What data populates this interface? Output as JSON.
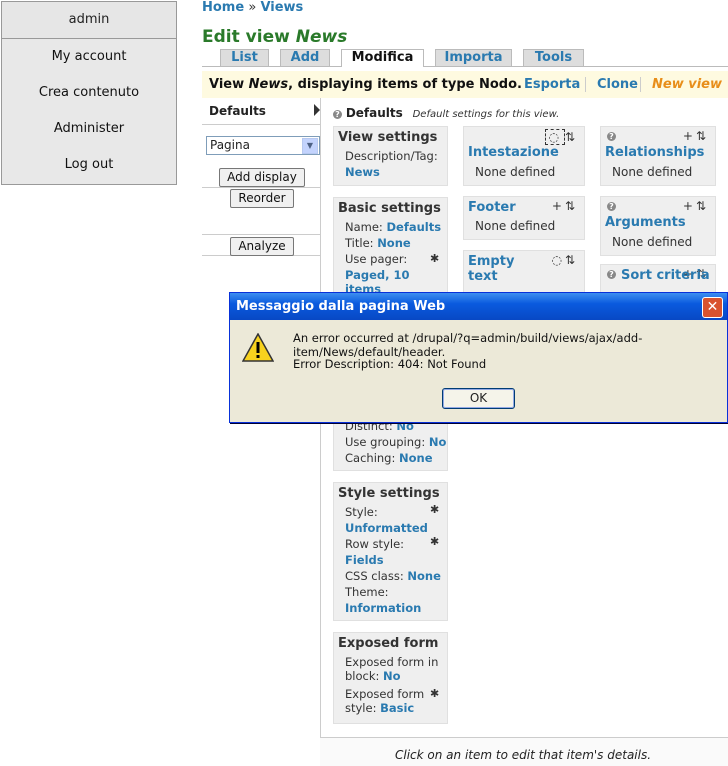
{
  "user_menu": {
    "username": "admin",
    "items": [
      "My account",
      "Crea contenuto",
      "Administer",
      "Log out"
    ]
  },
  "breadcrumb": {
    "home": "Home",
    "sep": "»",
    "views": "Views"
  },
  "title": {
    "prefix": "Edit view",
    "name": "News"
  },
  "tabs": [
    "List",
    "Add",
    "Modifica",
    "Importa",
    "Tools"
  ],
  "active_tab": "Modifica",
  "infobar": {
    "text_prefix": "View",
    "view_name": "News",
    "text_suffix": ", displaying items of type Nodo.",
    "export": "Esporta",
    "clone": "Clone",
    "new_view": "New view"
  },
  "displays": {
    "defaults": "Defaults",
    "select_value": "Pagina",
    "add_display": "Add display",
    "reorder": "Reorder",
    "analyze": "Analyze"
  },
  "defaults_header": {
    "title": "Defaults",
    "desc": "Default settings for this view."
  },
  "view_settings": {
    "title": "View settings",
    "desc_label": "Description/Tag:",
    "desc_value": "News"
  },
  "basic_settings": {
    "title": "Basic settings",
    "name_label": "Name:",
    "name_value": "Defaults",
    "title_label": "Title:",
    "title_value": "None",
    "pager_label": "Use pager:",
    "pager_value": "Paged, 10 items",
    "distinct_label": "Distinct:",
    "distinct_value": "No",
    "grouping_label": "Use grouping:",
    "grouping_value": "No",
    "caching_label": "Caching:",
    "caching_value": "None"
  },
  "style_settings": {
    "title": "Style settings",
    "style_label": "Style:",
    "style_value": "Unformatted",
    "row_label": "Row style:",
    "row_value": "Fields",
    "css_label": "CSS class:",
    "css_value": "None",
    "theme_label": "Theme:",
    "theme_value": "Information"
  },
  "exposed_form": {
    "title": "Exposed form",
    "block_label": "Exposed form in block:",
    "block_value": "No",
    "style_label": "Exposed form style:",
    "style_value": "Basic"
  },
  "intestazione": {
    "title": "Intestazione",
    "value": "None defined"
  },
  "footer": {
    "title": "Footer",
    "value": "None defined"
  },
  "empty_text": {
    "title": "Empty text"
  },
  "relationships": {
    "title": "Relationships",
    "value": "None defined"
  },
  "arguments": {
    "title": "Arguments",
    "value": "None defined"
  },
  "sort_criteria": {
    "title": "Sort criteria"
  },
  "footer_hint": "Click on an item to edit that item's details.",
  "dialog": {
    "title": "Messaggio dalla pagina Web",
    "message": "An error occurred at /drupal/?q=admin/build/views/ajax/add-item/News/default/header.",
    "error": "Error Description: 404: Not Found",
    "ok": "OK"
  }
}
